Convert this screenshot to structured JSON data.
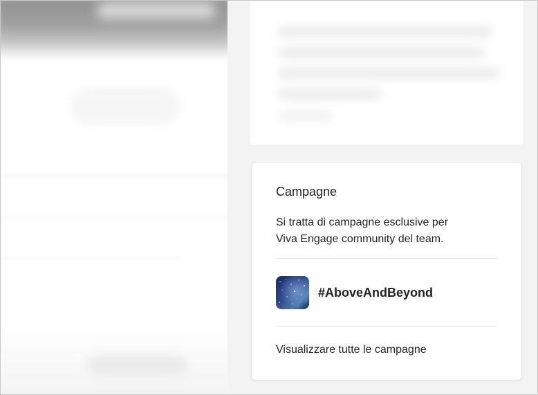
{
  "campaigns_card": {
    "title": "Campagne",
    "description_line1": "Si tratta di campagne esclusive per",
    "description_line2": "Viva Engage community del team.",
    "items": [
      {
        "name": "#AboveAndBeyond",
        "thumbnail_icon": "starry-night-image"
      }
    ],
    "see_all_link": "Visualizzare tutte le campagne"
  },
  "colors": {
    "text": "#242424",
    "background": "#f3f3f3",
    "card": "#ffffff",
    "divider": "#e3e3e3"
  }
}
